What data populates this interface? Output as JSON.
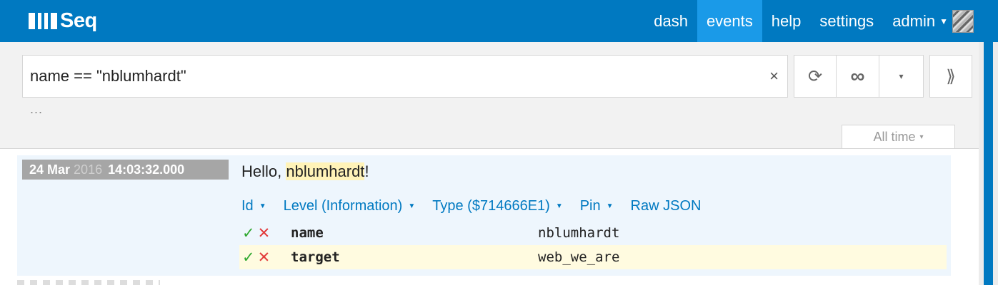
{
  "app": {
    "logo_text": "Seq"
  },
  "nav": {
    "items": [
      {
        "label": "dash"
      },
      {
        "label": "events",
        "active": true
      },
      {
        "label": "help"
      },
      {
        "label": "settings"
      }
    ],
    "user": "admin"
  },
  "query": {
    "value": "name == \"nblumhardt\"",
    "clear_glyph": "×",
    "ellipsis": "..."
  },
  "toolbar": {
    "refresh_glyph": "⟳",
    "tail_glyph": "∞",
    "caret_glyph": "▾",
    "expand_glyph": "⟫"
  },
  "range": {
    "label": "All time",
    "caret": "▾"
  },
  "event": {
    "date": "24 Mar",
    "year": "2016",
    "time": "14:03:32.000",
    "message_prefix": "Hello, ",
    "message_highlight": "nblumhardt",
    "message_suffix": "!",
    "actions": [
      {
        "label": "Id",
        "has_caret": true
      },
      {
        "label": "Level (Information)",
        "has_caret": true
      },
      {
        "label": "Type ($714666E1)",
        "has_caret": true
      },
      {
        "label": "Pin",
        "has_caret": true
      },
      {
        "label": "Raw JSON",
        "has_caret": false
      }
    ],
    "properties": [
      {
        "name": "name",
        "value": "nblumhardt",
        "highlighted": false
      },
      {
        "name": "target",
        "value": "web_we_are",
        "highlighted": true
      }
    ]
  },
  "colors": {
    "topbar": "#0079c1",
    "nav_active": "#1a9ae8",
    "event_bg": "#eef6fd",
    "include": "#2fa82f",
    "exclude": "#e23b3b"
  }
}
